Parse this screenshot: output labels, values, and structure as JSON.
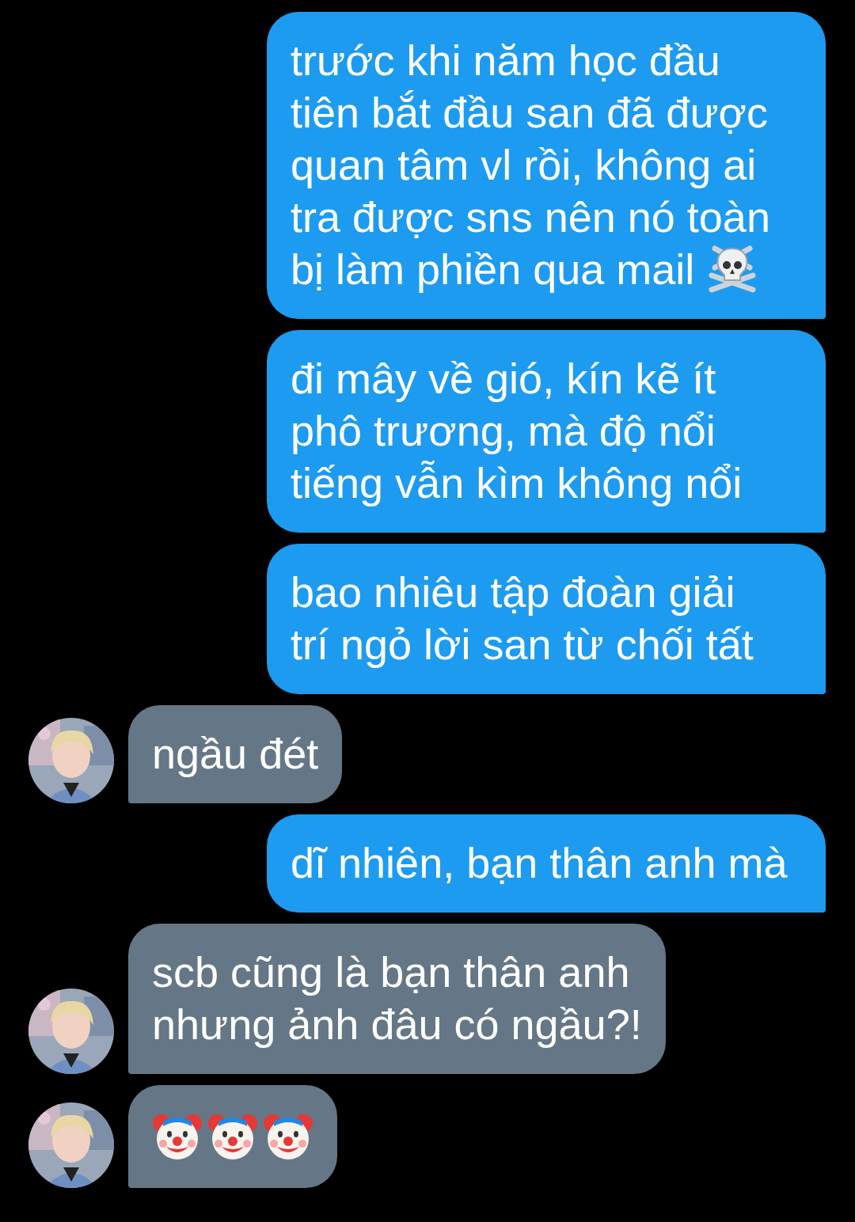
{
  "messages": [
    {
      "kind": "sent",
      "lines": [
        "trước khi năm học đầu",
        "tiên bắt đầu san đã được",
        "quan tâm vl rồi, không ai",
        "tra được sns nên nó toàn",
        "bị làm phiền qua mail"
      ],
      "ends_with_skull": true
    },
    {
      "kind": "sent",
      "lines": [
        "đi mây về gió, kín kẽ ít",
        "phô trương, mà độ nổi",
        "tiếng vẫn kìm không nổi"
      ]
    },
    {
      "kind": "sent",
      "lines": [
        "bao nhiêu tập đoàn giải",
        "trí ngỏ lời san từ chối tất"
      ]
    },
    {
      "kind": "received",
      "lines": [
        "ngầu đét"
      ]
    },
    {
      "kind": "sent",
      "lines": [
        "dĩ nhiên, bạn thân anh mà"
      ]
    },
    {
      "kind": "received",
      "lines": [
        "scb cũng là bạn thân anh",
        "nhưng ảnh đâu có ngầu?!"
      ]
    },
    {
      "kind": "received",
      "icons": [
        {
          "kind": "clown"
        },
        {
          "kind": "clown"
        },
        {
          "kind": "clown"
        }
      ]
    }
  ]
}
